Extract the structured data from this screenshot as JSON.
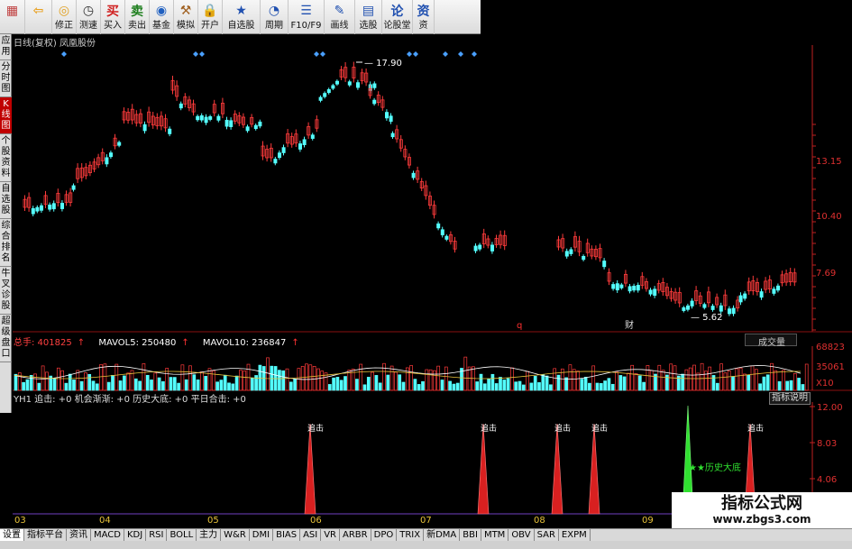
{
  "toolbar": {
    "buttons": [
      {
        "label": "",
        "icon": "grid-icon",
        "color": "#c04040"
      },
      {
        "label": "",
        "icon": "back-arrow-icon",
        "color": "#e8a020"
      },
      {
        "label": "修正",
        "icon": "fix-icon",
        "color": "#e0a020"
      },
      {
        "label": "测速",
        "icon": "speed-icon",
        "color": "#303030"
      },
      {
        "label": "买入",
        "icon": "buy-icon",
        "color": "#d02020"
      },
      {
        "label": "卖出",
        "icon": "sell-icon",
        "color": "#208020"
      },
      {
        "label": "基金",
        "icon": "fund-icon",
        "color": "#2060c0"
      },
      {
        "label": "模拟",
        "icon": "simulate-icon",
        "color": "#a06020"
      },
      {
        "label": "开户",
        "icon": "lock-icon",
        "color": "#a08020"
      },
      {
        "label": "自选股",
        "icon": "star-icon",
        "color": "#2050b0"
      },
      {
        "label": "周期",
        "icon": "clock-icon",
        "color": "#2050b0"
      },
      {
        "label": "F10/F9",
        "icon": "document-icon",
        "color": "#2050b0"
      },
      {
        "label": "画线",
        "icon": "pen-icon",
        "color": "#2050b0"
      },
      {
        "label": "选股",
        "icon": "screen-icon",
        "color": "#2050b0"
      },
      {
        "label": "论股堂",
        "icon": "chat-icon",
        "color": "#2050b0"
      },
      {
        "label": "资",
        "icon": "info-icon",
        "color": "#2050b0"
      }
    ]
  },
  "sidebar": {
    "items": [
      {
        "label": "应用",
        "active": false
      },
      {
        "label": "分时图",
        "active": false
      },
      {
        "label": "K线图",
        "active": true
      },
      {
        "label": "个股资料",
        "active": false
      },
      {
        "label": "自选股",
        "active": false
      },
      {
        "label": "综合排名",
        "active": false
      },
      {
        "label": "牛叉诊股",
        "active": false
      },
      {
        "label": "超级盘口",
        "active": false
      }
    ]
  },
  "chart": {
    "title": "日线(复权) 凤凰股份",
    "price_ticks": [
      "13.15",
      "10.40",
      "7.69"
    ],
    "high_label": "17.90",
    "low_label": "5.62",
    "marker_q": "q",
    "marker_cai": "财",
    "up_color": "#ff3b3b",
    "down_color": "#54ffff",
    "price_axis_color": "#c02020"
  },
  "volume": {
    "total_label": "总手: 401825",
    "mavol5_label": "MAVOL5: 250480",
    "mavol10_label": "MAVOL10: 236847",
    "dropdown": "成交量",
    "ticks": [
      "68823",
      "35061",
      "X10"
    ]
  },
  "indicator": {
    "header": "YH1 追击: +0   机会渐渐: +0   历史大底: +0   平日合击: +0",
    "explain_button": "指标说明",
    "ticks": [
      "12.00",
      "8.03",
      "4.06"
    ],
    "signal_label": "追击",
    "bottom_label": "★★历史大底"
  },
  "dates": [
    "03",
    "04",
    "05",
    "06",
    "07",
    "08",
    "09"
  ],
  "tabs": [
    "设置",
    "指标平台",
    "资讯",
    "MACD",
    "KDJ",
    "RSI",
    "BOLL",
    "主力",
    "W&R",
    "DMI",
    "BIAS",
    "ASI",
    "VR",
    "ARBR",
    "DPO",
    "TRIX",
    "新DMA",
    "BBI",
    "MTM",
    "OBV",
    "SAR",
    "EXPM"
  ],
  "active_tab": "设置",
  "watermark": {
    "title": "指标公式网",
    "url": "www.zbgs3.com"
  }
}
